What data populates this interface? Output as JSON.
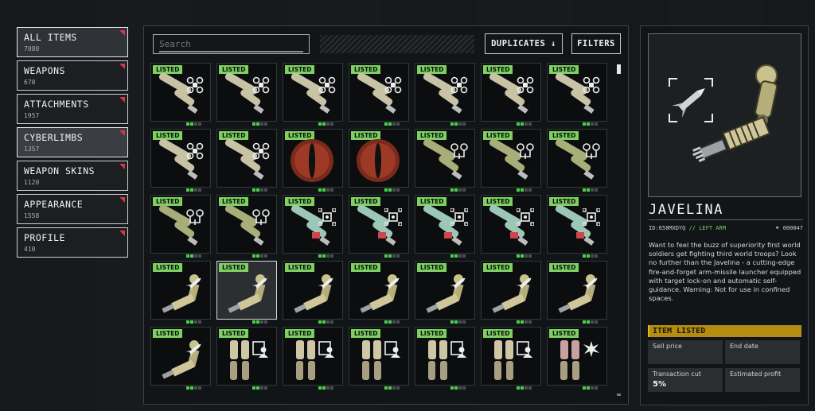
{
  "sidebar": {
    "items": [
      {
        "label": "ALL ITEMS",
        "count": "7080"
      },
      {
        "label": "WEAPONS",
        "count": "670"
      },
      {
        "label": "ATTACHMENTS",
        "count": "1957"
      },
      {
        "label": "CYBERLIMBS",
        "count": "1357"
      },
      {
        "label": "WEAPON SKINS",
        "count": "1120"
      },
      {
        "label": "APPEARANCE",
        "count": "1558"
      },
      {
        "label": "PROFILE",
        "count": "410"
      }
    ],
    "active_indices": [
      0,
      3
    ]
  },
  "toolbar": {
    "search_placeholder": "Search",
    "duplicates_label": "DUPLICATES ↓",
    "filters_label": "FILTERS"
  },
  "grid": {
    "badge": "LISTED",
    "selected_cell": "r3c1",
    "rows": [
      [
        "drone-arm",
        "drone-arm",
        "drone-arm",
        "drone-arm",
        "drone-arm",
        "drone-arm",
        "drone-arm"
      ],
      [
        "drone-arm",
        "drone-arm",
        "eye-orb",
        "eye-orb",
        "tree-arm",
        "tree-arm",
        "tree-arm"
      ],
      [
        "tree-arm",
        "tree-arm",
        "target-arm",
        "target-arm",
        "target-arm",
        "target-arm",
        "target-arm"
      ],
      [
        "missile-arm",
        "missile-arm",
        "missile-arm",
        "missile-arm",
        "missile-arm",
        "missile-arm",
        "missile-arm"
      ],
      [
        "missile-arm",
        "legs",
        "legs",
        "legs",
        "legs",
        "legs",
        "blast-legs"
      ]
    ]
  },
  "detail": {
    "title": "JAVELINA",
    "id": "ID:658MXDYQ",
    "slot": "// LEFT ARM",
    "price": "000047",
    "description": "Want to feel the buzz of superiority first world soldiers get fighting third world troops? Look no further than the Javelina - a cutting-edge fire-and-forget arm-missile launcher equipped with target lock-on and automatic self-guidance. Warning: Not for use in confined spaces.",
    "status_banner": "ITEM LISTED",
    "fields": {
      "sell_price": {
        "label": "Sell price",
        "value": ""
      },
      "end_date": {
        "label": "End date",
        "value": ""
      },
      "transaction_cut": {
        "label": "Transaction cut",
        "value": "5%"
      },
      "estimated_profit": {
        "label": "Estimated profit",
        "value": ""
      }
    }
  },
  "colors": {
    "listed_badge": "#7cd160",
    "accent_flag": "#e0334a",
    "banner": "#b48c12",
    "pip_on": "#4bd14b"
  }
}
